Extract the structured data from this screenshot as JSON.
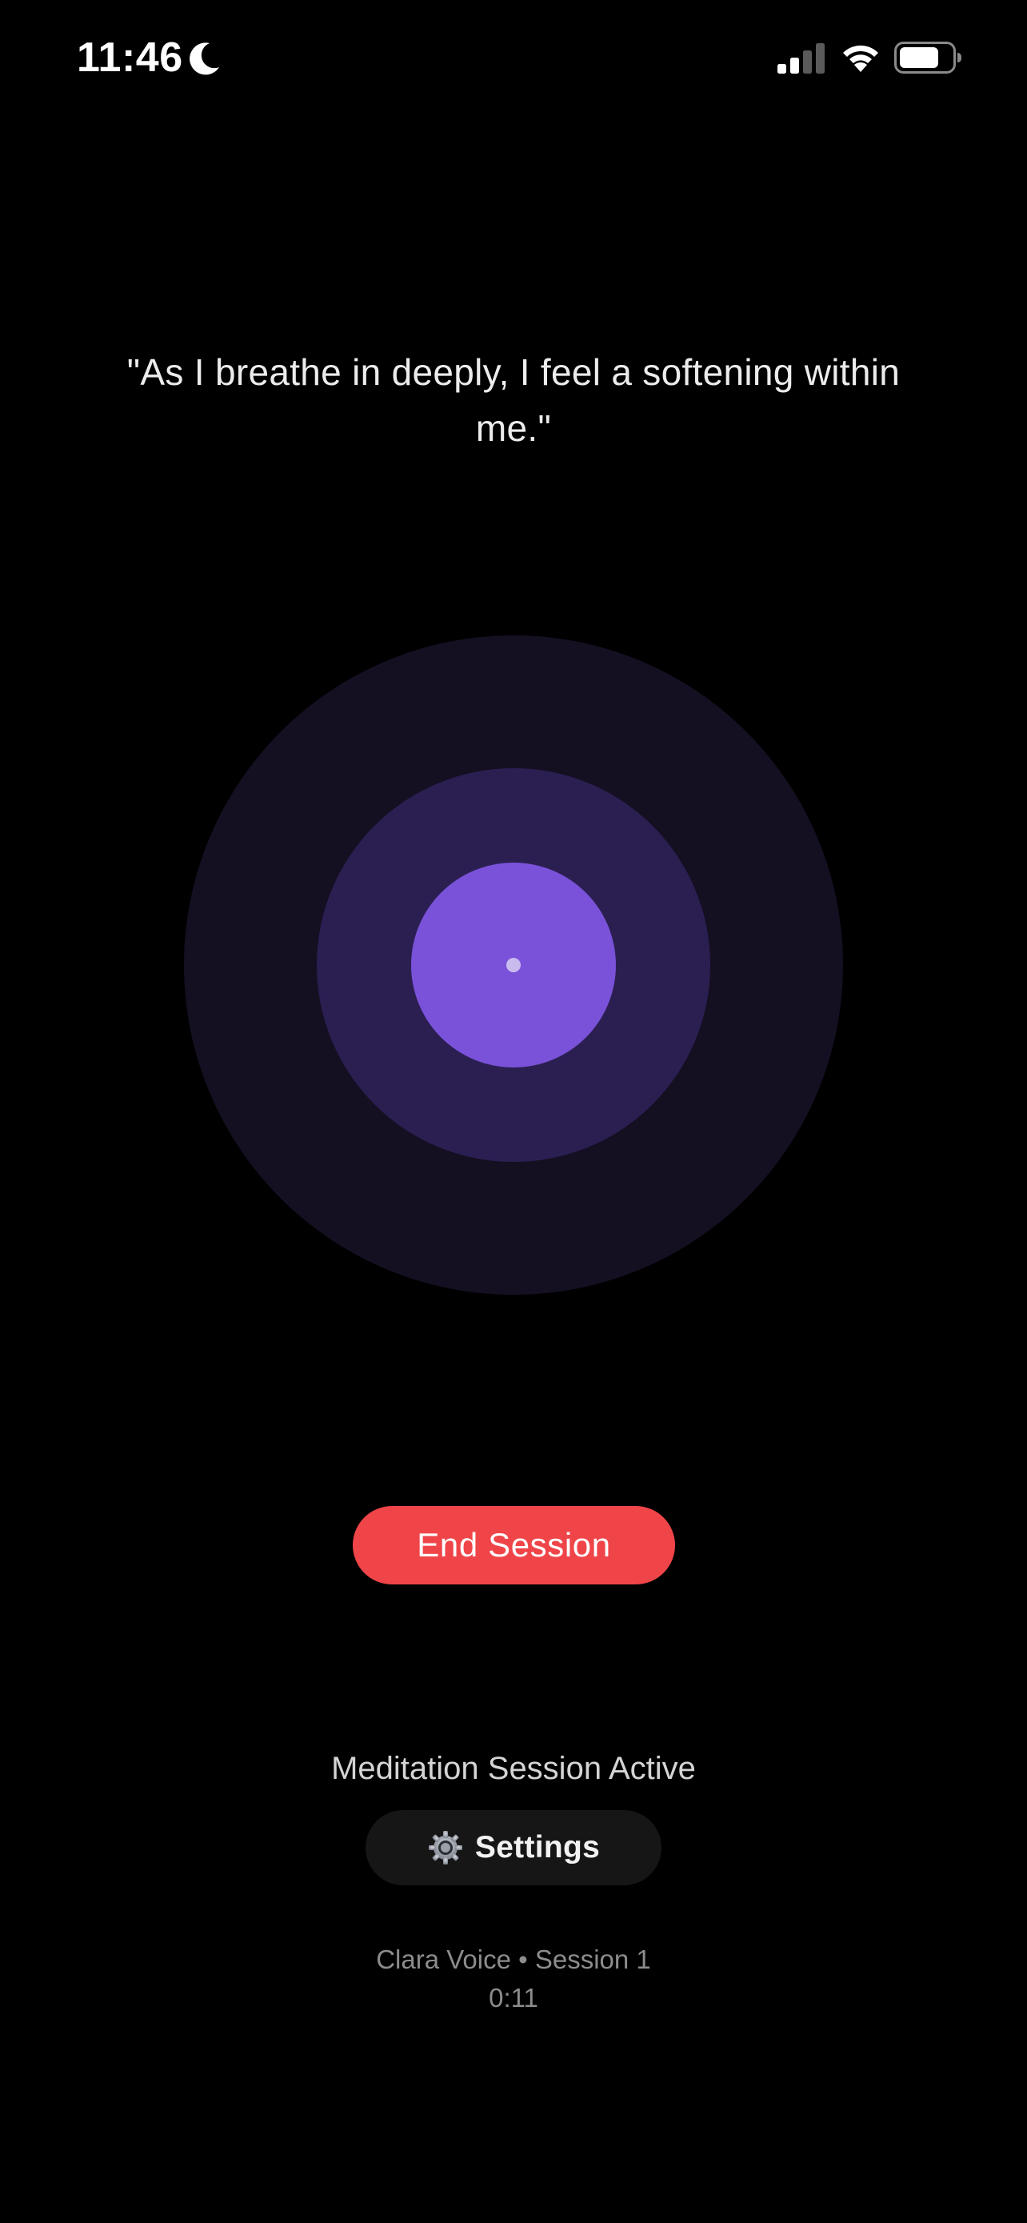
{
  "status_bar": {
    "time": "11:46",
    "focus_icon": "moon-icon",
    "signal_icon": "cellular-signal-icon",
    "wifi_icon": "wifi-icon",
    "battery_icon": "battery-icon"
  },
  "affirmation": "\"As I breathe in deeply, I feel a softening within me.\"",
  "orb": {
    "icon": "breathing-orb",
    "colors": {
      "outer": "#150f22",
      "middle": "#2b1f52",
      "inner": "#7a52d9",
      "dot": "#c9bbee"
    }
  },
  "actions": {
    "end_session_label": "End Session",
    "end_session_color": "#ef4549"
  },
  "session": {
    "status": "Meditation Session Active",
    "settings_label": "Settings",
    "settings_icon": "gear-icon",
    "info": "Clara Voice • Session 1",
    "timer": "0:11"
  }
}
